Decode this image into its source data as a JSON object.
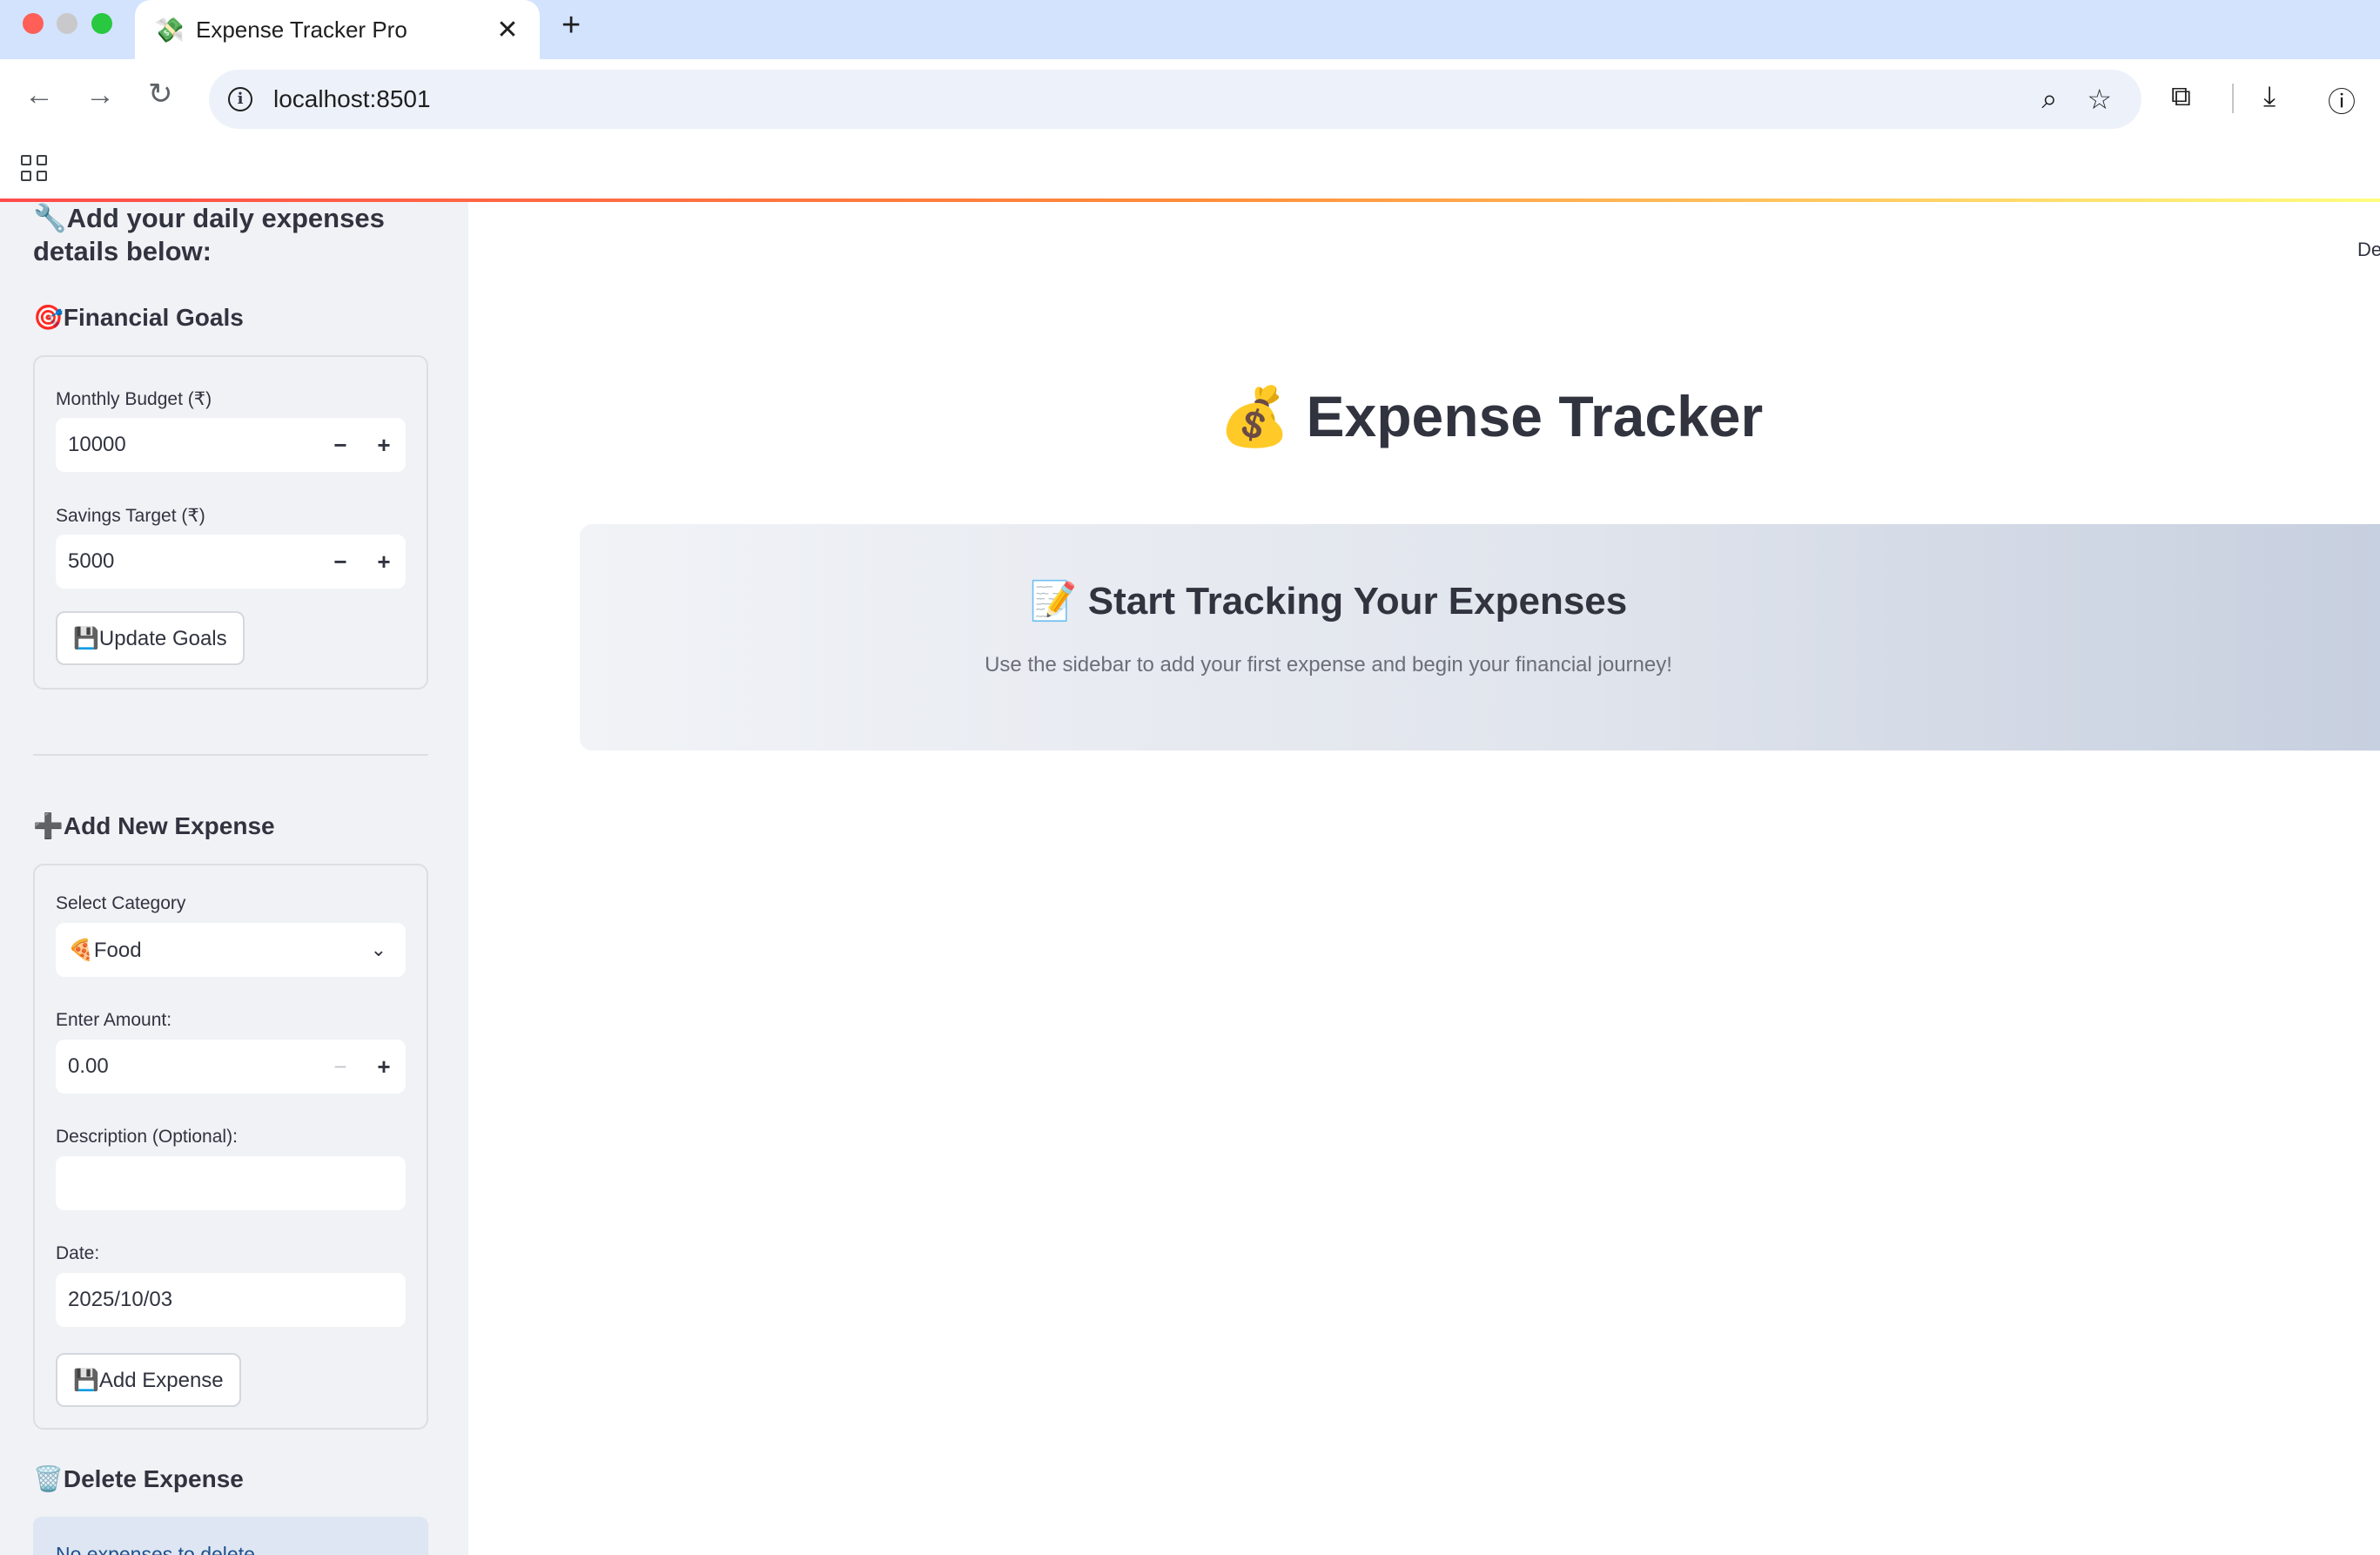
{
  "browser": {
    "tab_title": "Expense Tracker Pro",
    "tab_favicon": "💸",
    "url": "localhost:8501"
  },
  "header": {
    "deploy_label": "De"
  },
  "sidebar": {
    "heading": "🔧Add your daily expenses details below:",
    "financial_goals": {
      "title": "🎯Financial Goals",
      "monthly_budget_label": "Monthly Budget (₹)",
      "monthly_budget_value": "10000",
      "savings_target_label": "Savings Target (₹)",
      "savings_target_value": "5000",
      "update_button": "💾Update Goals"
    },
    "add_expense": {
      "title": "➕Add New Expense",
      "category_label": "Select Category",
      "category_value": "🍕Food",
      "amount_label": "Enter Amount:",
      "amount_value": "0.00",
      "description_label": "Description (Optional):",
      "description_value": "",
      "date_label": "Date:",
      "date_value": "2025/10/03",
      "add_button": "💾Add Expense"
    },
    "delete_expense": {
      "title": "🗑️Delete Expense",
      "info": "No expenses to delete."
    }
  },
  "main": {
    "title": "💰 Expense Tracker",
    "banner_title": "📝 Start Tracking Your Expenses",
    "banner_subtitle": "Use the sidebar to add your first expense and begin your financial journey!"
  }
}
